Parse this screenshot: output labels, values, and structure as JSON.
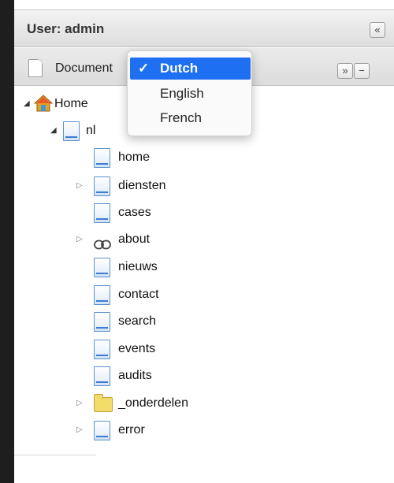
{
  "panel": {
    "title": "User: admin",
    "collapse_label": "«"
  },
  "toolbar": {
    "label": "Document",
    "expand_label": "»",
    "minus_label": "−"
  },
  "language_dropdown": {
    "options": [
      {
        "label": "Dutch",
        "selected": true,
        "check": "✓"
      },
      {
        "label": "English",
        "selected": false
      },
      {
        "label": "French",
        "selected": false
      }
    ]
  },
  "tree": {
    "root": {
      "label": "Home",
      "icon": "house-icon",
      "toggle": "◢"
    },
    "nl": {
      "label": "nl",
      "icon": "document-icon",
      "toggle": "◢"
    },
    "children": [
      {
        "label": "home",
        "icon": "document-icon",
        "toggle": ""
      },
      {
        "label": "diensten",
        "icon": "document-icon",
        "toggle": "▷"
      },
      {
        "label": "cases",
        "icon": "document-icon",
        "toggle": ""
      },
      {
        "label": "about",
        "icon": "link-icon",
        "toggle": "▷"
      },
      {
        "label": "nieuws",
        "icon": "document-icon",
        "toggle": ""
      },
      {
        "label": "contact",
        "icon": "document-icon",
        "toggle": ""
      },
      {
        "label": "search",
        "icon": "document-icon",
        "toggle": ""
      },
      {
        "label": "events",
        "icon": "document-icon",
        "toggle": ""
      },
      {
        "label": "audits",
        "icon": "document-icon",
        "toggle": ""
      },
      {
        "label": "_onderdelen",
        "icon": "folder-icon",
        "toggle": "▷"
      },
      {
        "label": "error",
        "icon": "document-icon",
        "toggle": "▷"
      }
    ]
  },
  "colors": {
    "selection": "#1e6ff1",
    "doc_border": "#5d92cc",
    "folder": "#f3dc6a",
    "left_bar": "#1e1e1e"
  }
}
